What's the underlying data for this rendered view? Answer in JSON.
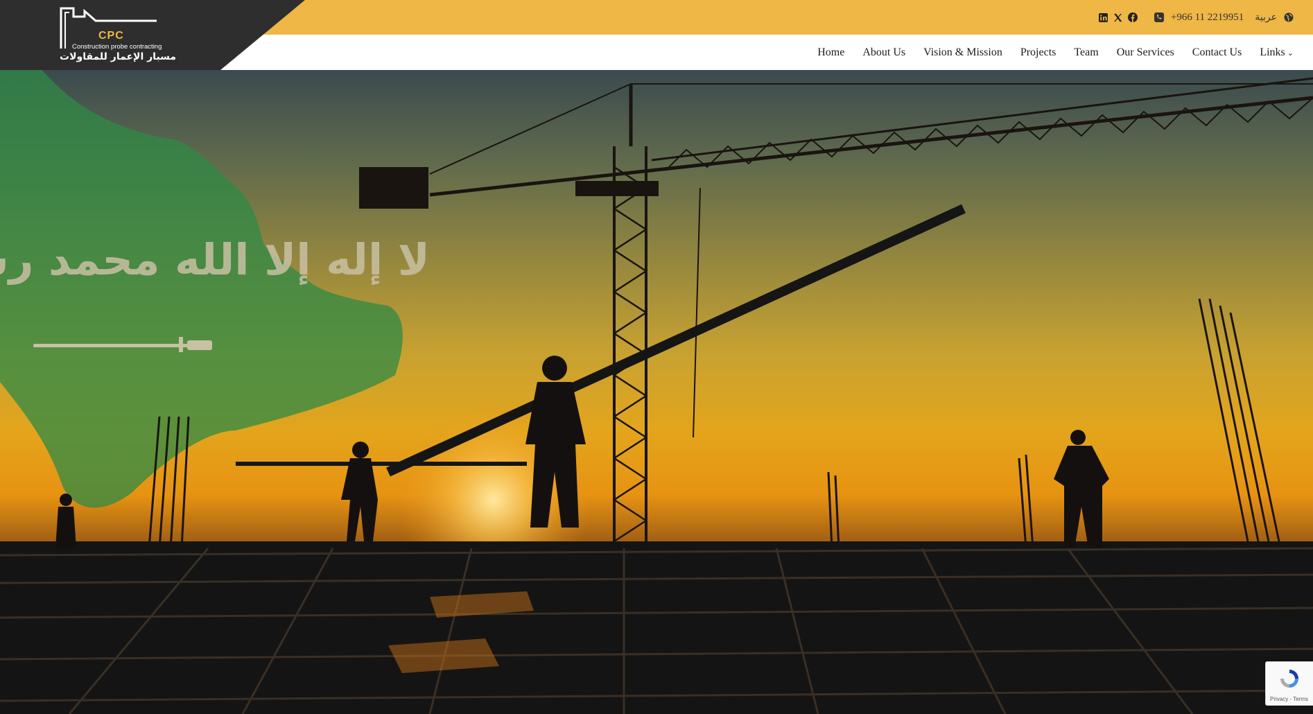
{
  "brand": {
    "short_name": "CPC",
    "english_name": "Construction probe contracting",
    "arabic_name": "مسبار الإعمار للمقاولات",
    "colors": {
      "accent": "#eeb746",
      "dark": "#2e2e2e",
      "flag_green": "#2f8a45"
    }
  },
  "topbar": {
    "social": [
      {
        "name": "linkedin-icon"
      },
      {
        "name": "x-icon"
      },
      {
        "name": "facebook-icon"
      }
    ],
    "phone_icon": "phone-icon",
    "phone": "+966 11 2219951",
    "language_label": "عربية",
    "language_icon": "globe-icon"
  },
  "nav": {
    "items": [
      {
        "label": "Home"
      },
      {
        "label": "About Us"
      },
      {
        "label": "Vision & Mission"
      },
      {
        "label": "Projects"
      },
      {
        "label": "Team"
      },
      {
        "label": "Our Services"
      },
      {
        "label": "Contact Us"
      },
      {
        "label": "Links",
        "has_dropdown": true
      }
    ]
  },
  "hero": {
    "flag_text": "لا إله إلا الله محمد رسول الله",
    "image": "construction-workers-sunset-crane"
  },
  "recaptcha": {
    "label": "Privacy - Terms"
  }
}
